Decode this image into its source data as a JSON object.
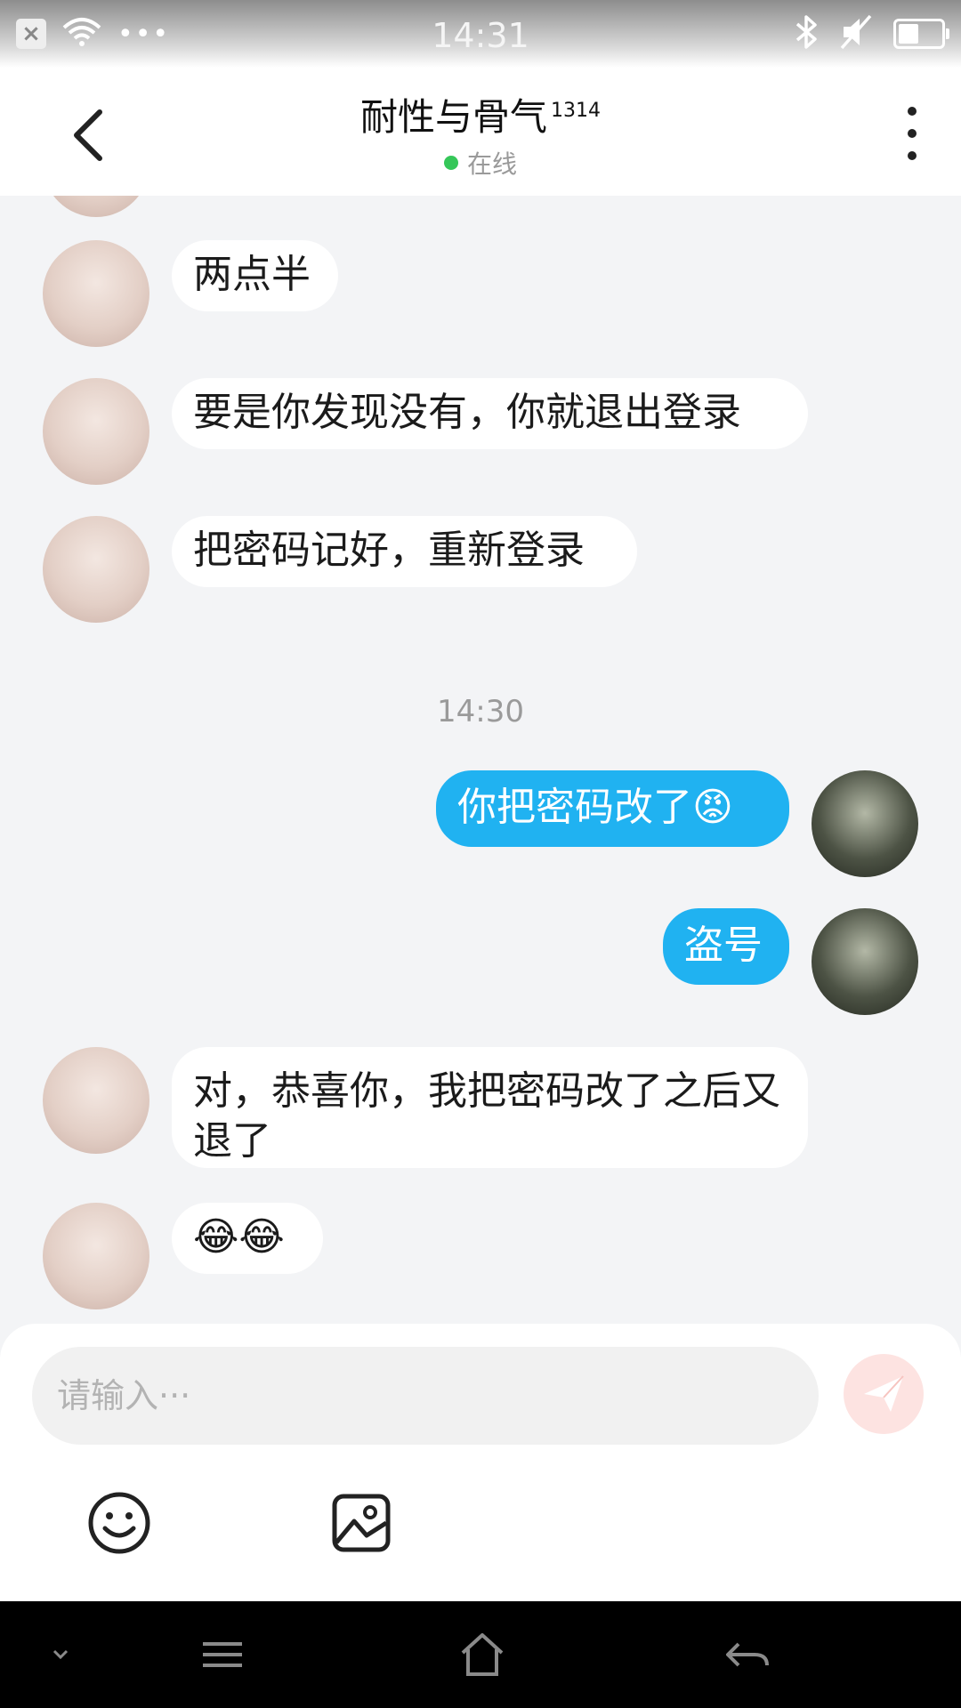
{
  "status_bar": {
    "time": "14:31",
    "left_icons": [
      "notification-closed-icon",
      "wifi-icon",
      "more-dots-icon"
    ],
    "right_icons": [
      "bluetooth-icon",
      "mute-icon",
      "battery-icon"
    ],
    "more_dots": "•••"
  },
  "header": {
    "title": "耐性与骨气",
    "title_suffix": "1314",
    "status": "在线",
    "online_color": "#35c759"
  },
  "chat": {
    "messages": [
      {
        "side": "in",
        "text": "两点半"
      },
      {
        "side": "in",
        "text": "要是你发现没有，你就退出登录"
      },
      {
        "side": "in",
        "text": "把密码记好，重新登录"
      },
      {
        "side": "out",
        "text": "你把密码改了😡"
      },
      {
        "side": "out",
        "text": "盗号"
      },
      {
        "side": "in",
        "text": "对，恭喜你，我把密码改了之后又退了"
      },
      {
        "side": "in",
        "text": "😂😂"
      }
    ],
    "timestamp": "14:30",
    "outgoing_color": "#20b2f1"
  },
  "composer": {
    "placeholder": "请输入···",
    "tools": [
      "emoji-icon",
      "image-icon"
    ],
    "send_color": "#fde3e1"
  },
  "nav_bar": {
    "buttons": [
      "chevron-down-icon",
      "menu-icon",
      "home-icon",
      "back-arrow-icon"
    ]
  }
}
